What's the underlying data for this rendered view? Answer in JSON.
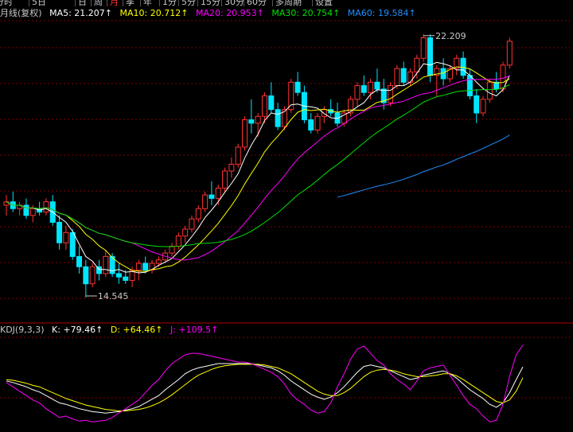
{
  "period_tabs": [
    {
      "label": "分时",
      "active": false
    },
    {
      "label": "5日",
      "active": false
    },
    {
      "label": "日",
      "active": false
    },
    {
      "label": "周",
      "active": false
    },
    {
      "label": "月",
      "active": true
    },
    {
      "label": "季",
      "active": false
    },
    {
      "label": "年",
      "active": false
    },
    {
      "label": "1分",
      "active": false
    },
    {
      "label": "5分",
      "active": false
    },
    {
      "label": "15分",
      "active": false
    },
    {
      "label": "30分",
      "active": false
    },
    {
      "label": "60分",
      "active": false
    },
    {
      "label": "多周期",
      "active": false
    },
    {
      "label": "设置",
      "active": false
    }
  ],
  "price_legend": {
    "chart_name": "月线(复权)",
    "ma5": "MA5: 21.207↑",
    "ma10": "MA10: 20.712↑",
    "ma20": "MA20: 20.953↑",
    "ma30": "MA30: 20.754↑",
    "ma60": "MA60: 19.584↑"
  },
  "kdj_legend": {
    "name": "KDJ(9,3,3)",
    "k": "K: +79.46↑",
    "d": "D: +64.46↑",
    "j": "J: +109.5↑"
  },
  "colors": {
    "up": "#ff3232",
    "down": "#00e5ff",
    "ma5": "#ffffff",
    "ma10": "#ffff00",
    "ma20": "#ff00ff",
    "ma30": "#00e000",
    "ma60": "#1e90ff",
    "kdj_k": "#ffffff",
    "kdj_d": "#ffff00",
    "kdj_j": "#ff00ff",
    "grid": "#7a0000",
    "legend_label": "#c8c8c8",
    "annotation": "#c8c8c8"
  },
  "chart_data": [
    {
      "type": "candlestick",
      "title": "月线(复权)",
      "price_range": [
        13.8,
        22.6
      ],
      "annotations": [
        {
          "label": "22.209",
          "value": 22.209,
          "kind": "high"
        },
        {
          "label": "14.545",
          "value": 14.545,
          "kind": "low"
        }
      ],
      "candles": [
        [
          17.2,
          17.5,
          16.9,
          17.3
        ],
        [
          17.3,
          17.6,
          17.0,
          17.1
        ],
        [
          17.1,
          17.3,
          16.9,
          17.2
        ],
        [
          17.2,
          17.4,
          16.8,
          16.9
        ],
        [
          16.9,
          17.2,
          16.7,
          17.1
        ],
        [
          17.1,
          17.3,
          16.9,
          17.0
        ],
        [
          17.0,
          17.4,
          16.9,
          17.3
        ],
        [
          17.3,
          17.5,
          16.6,
          16.7
        ],
        [
          16.7,
          16.9,
          15.9,
          16.1
        ],
        [
          16.1,
          16.6,
          15.9,
          16.4
        ],
        [
          16.4,
          16.5,
          15.6,
          15.7
        ],
        [
          15.7,
          16.0,
          15.2,
          15.4
        ],
        [
          15.4,
          15.6,
          14.5,
          14.9
        ],
        [
          14.9,
          15.5,
          14.8,
          15.4
        ],
        [
          15.4,
          15.6,
          15.0,
          15.2
        ],
        [
          15.2,
          15.9,
          15.1,
          15.7
        ],
        [
          15.7,
          15.8,
          15.1,
          15.2
        ],
        [
          15.2,
          15.5,
          14.9,
          15.1
        ],
        [
          15.1,
          15.3,
          14.9,
          15.0
        ],
        [
          15.0,
          15.4,
          14.8,
          15.3
        ],
        [
          15.3,
          15.6,
          15.0,
          15.5
        ],
        [
          15.5,
          15.7,
          15.2,
          15.3
        ],
        [
          15.3,
          15.6,
          15.2,
          15.5
        ],
        [
          15.5,
          15.7,
          15.4,
          15.6
        ],
        [
          15.6,
          15.9,
          15.5,
          15.8
        ],
        [
          15.8,
          16.1,
          15.7,
          16.0
        ],
        [
          16.0,
          16.4,
          15.9,
          16.3
        ],
        [
          16.3,
          16.6,
          16.1,
          16.5
        ],
        [
          16.5,
          16.9,
          16.4,
          16.8
        ],
        [
          16.8,
          17.2,
          16.7,
          17.1
        ],
        [
          17.1,
          17.6,
          17.0,
          17.5
        ],
        [
          17.5,
          17.9,
          17.2,
          17.4
        ],
        [
          17.4,
          17.8,
          17.2,
          17.7
        ],
        [
          17.7,
          18.3,
          17.6,
          18.2
        ],
        [
          18.2,
          18.6,
          18.0,
          18.4
        ],
        [
          18.4,
          19.0,
          18.3,
          18.9
        ],
        [
          18.9,
          19.8,
          18.8,
          19.7
        ],
        [
          19.7,
          20.3,
          19.3,
          19.6
        ],
        [
          19.6,
          19.9,
          19.2,
          19.8
        ],
        [
          19.8,
          20.5,
          19.6,
          20.4
        ],
        [
          20.4,
          20.8,
          19.9,
          20.0
        ],
        [
          20.0,
          20.2,
          19.4,
          19.5
        ],
        [
          19.5,
          20.1,
          19.4,
          20.0
        ],
        [
          20.0,
          20.9,
          19.9,
          20.8
        ],
        [
          20.8,
          21.1,
          20.4,
          20.5
        ],
        [
          20.5,
          20.7,
          19.6,
          19.7
        ],
        [
          19.7,
          19.9,
          19.3,
          19.4
        ],
        [
          19.4,
          19.9,
          19.3,
          19.8
        ],
        [
          19.8,
          20.1,
          19.6,
          20.0
        ],
        [
          20.0,
          20.3,
          19.8,
          19.9
        ],
        [
          19.9,
          20.2,
          19.5,
          19.6
        ],
        [
          19.6,
          20.0,
          19.5,
          19.9
        ],
        [
          19.9,
          20.4,
          19.8,
          20.3
        ],
        [
          20.3,
          20.8,
          20.1,
          20.7
        ],
        [
          20.7,
          21.0,
          20.4,
          20.5
        ],
        [
          20.5,
          20.9,
          20.3,
          20.8
        ],
        [
          20.8,
          21.2,
          20.5,
          20.6
        ],
        [
          20.6,
          20.9,
          20.0,
          20.2
        ],
        [
          20.2,
          20.8,
          20.1,
          20.7
        ],
        [
          20.7,
          21.3,
          20.6,
          21.2
        ],
        [
          21.2,
          21.4,
          20.7,
          20.8
        ],
        [
          20.8,
          21.2,
          20.7,
          21.1
        ],
        [
          21.1,
          21.6,
          20.9,
          21.5
        ],
        [
          21.5,
          22.21,
          21.4,
          22.1
        ],
        [
          22.1,
          22.2,
          20.8,
          21.0
        ],
        [
          21.0,
          21.3,
          20.4,
          21.2
        ],
        [
          21.2,
          21.5,
          20.7,
          20.9
        ],
        [
          20.9,
          21.3,
          20.8,
          21.2
        ],
        [
          21.2,
          21.6,
          21.0,
          21.5
        ],
        [
          21.5,
          21.7,
          20.9,
          21.0
        ],
        [
          21.0,
          21.2,
          20.3,
          20.4
        ],
        [
          20.4,
          20.6,
          19.6,
          19.9
        ],
        [
          19.9,
          20.4,
          19.8,
          20.3
        ],
        [
          20.3,
          20.9,
          20.2,
          20.8
        ],
        [
          20.8,
          21.1,
          20.5,
          20.6
        ],
        [
          20.6,
          21.4,
          20.5,
          21.3
        ],
        [
          21.3,
          22.1,
          21.2,
          22.0
        ]
      ],
      "ma_series": [
        {
          "name": "MA5"
        },
        {
          "name": "MA10"
        },
        {
          "name": "MA20"
        },
        {
          "name": "MA30"
        },
        {
          "name": "MA60"
        }
      ]
    },
    {
      "type": "line",
      "title": "KDJ(9,3,3)",
      "ylim": [
        -10,
        120
      ],
      "series": [
        {
          "name": "K",
          "values": [
            60,
            58,
            55,
            52,
            48,
            45,
            40,
            35,
            30,
            28,
            25,
            22,
            20,
            18,
            17,
            16,
            17,
            18,
            20,
            22,
            25,
            30,
            35,
            40,
            48,
            55,
            62,
            70,
            75,
            78,
            80,
            82,
            84,
            84,
            84,
            84,
            84,
            84,
            82,
            80,
            78,
            74,
            68,
            60,
            54,
            48,
            42,
            38,
            35,
            38,
            44,
            52,
            62,
            72,
            80,
            82,
            80,
            78,
            74,
            70,
            66,
            62,
            64,
            68,
            70,
            72,
            74,
            70,
            64,
            56,
            48,
            42,
            36,
            28,
            24,
            30,
            44,
            62,
            79.46
          ]
        },
        {
          "name": "D",
          "values": [
            62,
            61,
            59,
            57,
            54,
            52,
            48,
            44,
            40,
            36,
            33,
            30,
            27,
            25,
            23,
            21,
            20,
            19,
            19,
            20,
            21,
            23,
            26,
            30,
            35,
            41,
            48,
            55,
            62,
            68,
            72,
            76,
            79,
            81,
            82,
            83,
            83,
            83,
            83,
            82,
            80,
            78,
            74,
            70,
            64,
            58,
            52,
            46,
            42,
            40,
            40,
            44,
            50,
            58,
            66,
            72,
            75,
            76,
            75,
            73,
            70,
            68,
            66,
            66,
            67,
            68,
            70,
            70,
            67,
            62,
            56,
            50,
            44,
            38,
            32,
            30,
            34,
            46,
            64.46
          ]
        },
        {
          "name": "J",
          "values": [
            58,
            52,
            46,
            40,
            34,
            30,
            22,
            16,
            10,
            12,
            8,
            5,
            6,
            4,
            5,
            6,
            10,
            16,
            22,
            28,
            34,
            44,
            54,
            62,
            74,
            84,
            90,
            96,
            98,
            98,
            96,
            94,
            92,
            90,
            88,
            86,
            86,
            84,
            80,
            76,
            72,
            66,
            56,
            42,
            34,
            28,
            20,
            16,
            18,
            30,
            52,
            70,
            90,
            104,
            108,
            98,
            88,
            82,
            70,
            62,
            56,
            48,
            60,
            74,
            78,
            80,
            82,
            68,
            54,
            40,
            28,
            22,
            12,
            4,
            6,
            28,
            66,
            96,
            109.5
          ]
        }
      ]
    }
  ]
}
